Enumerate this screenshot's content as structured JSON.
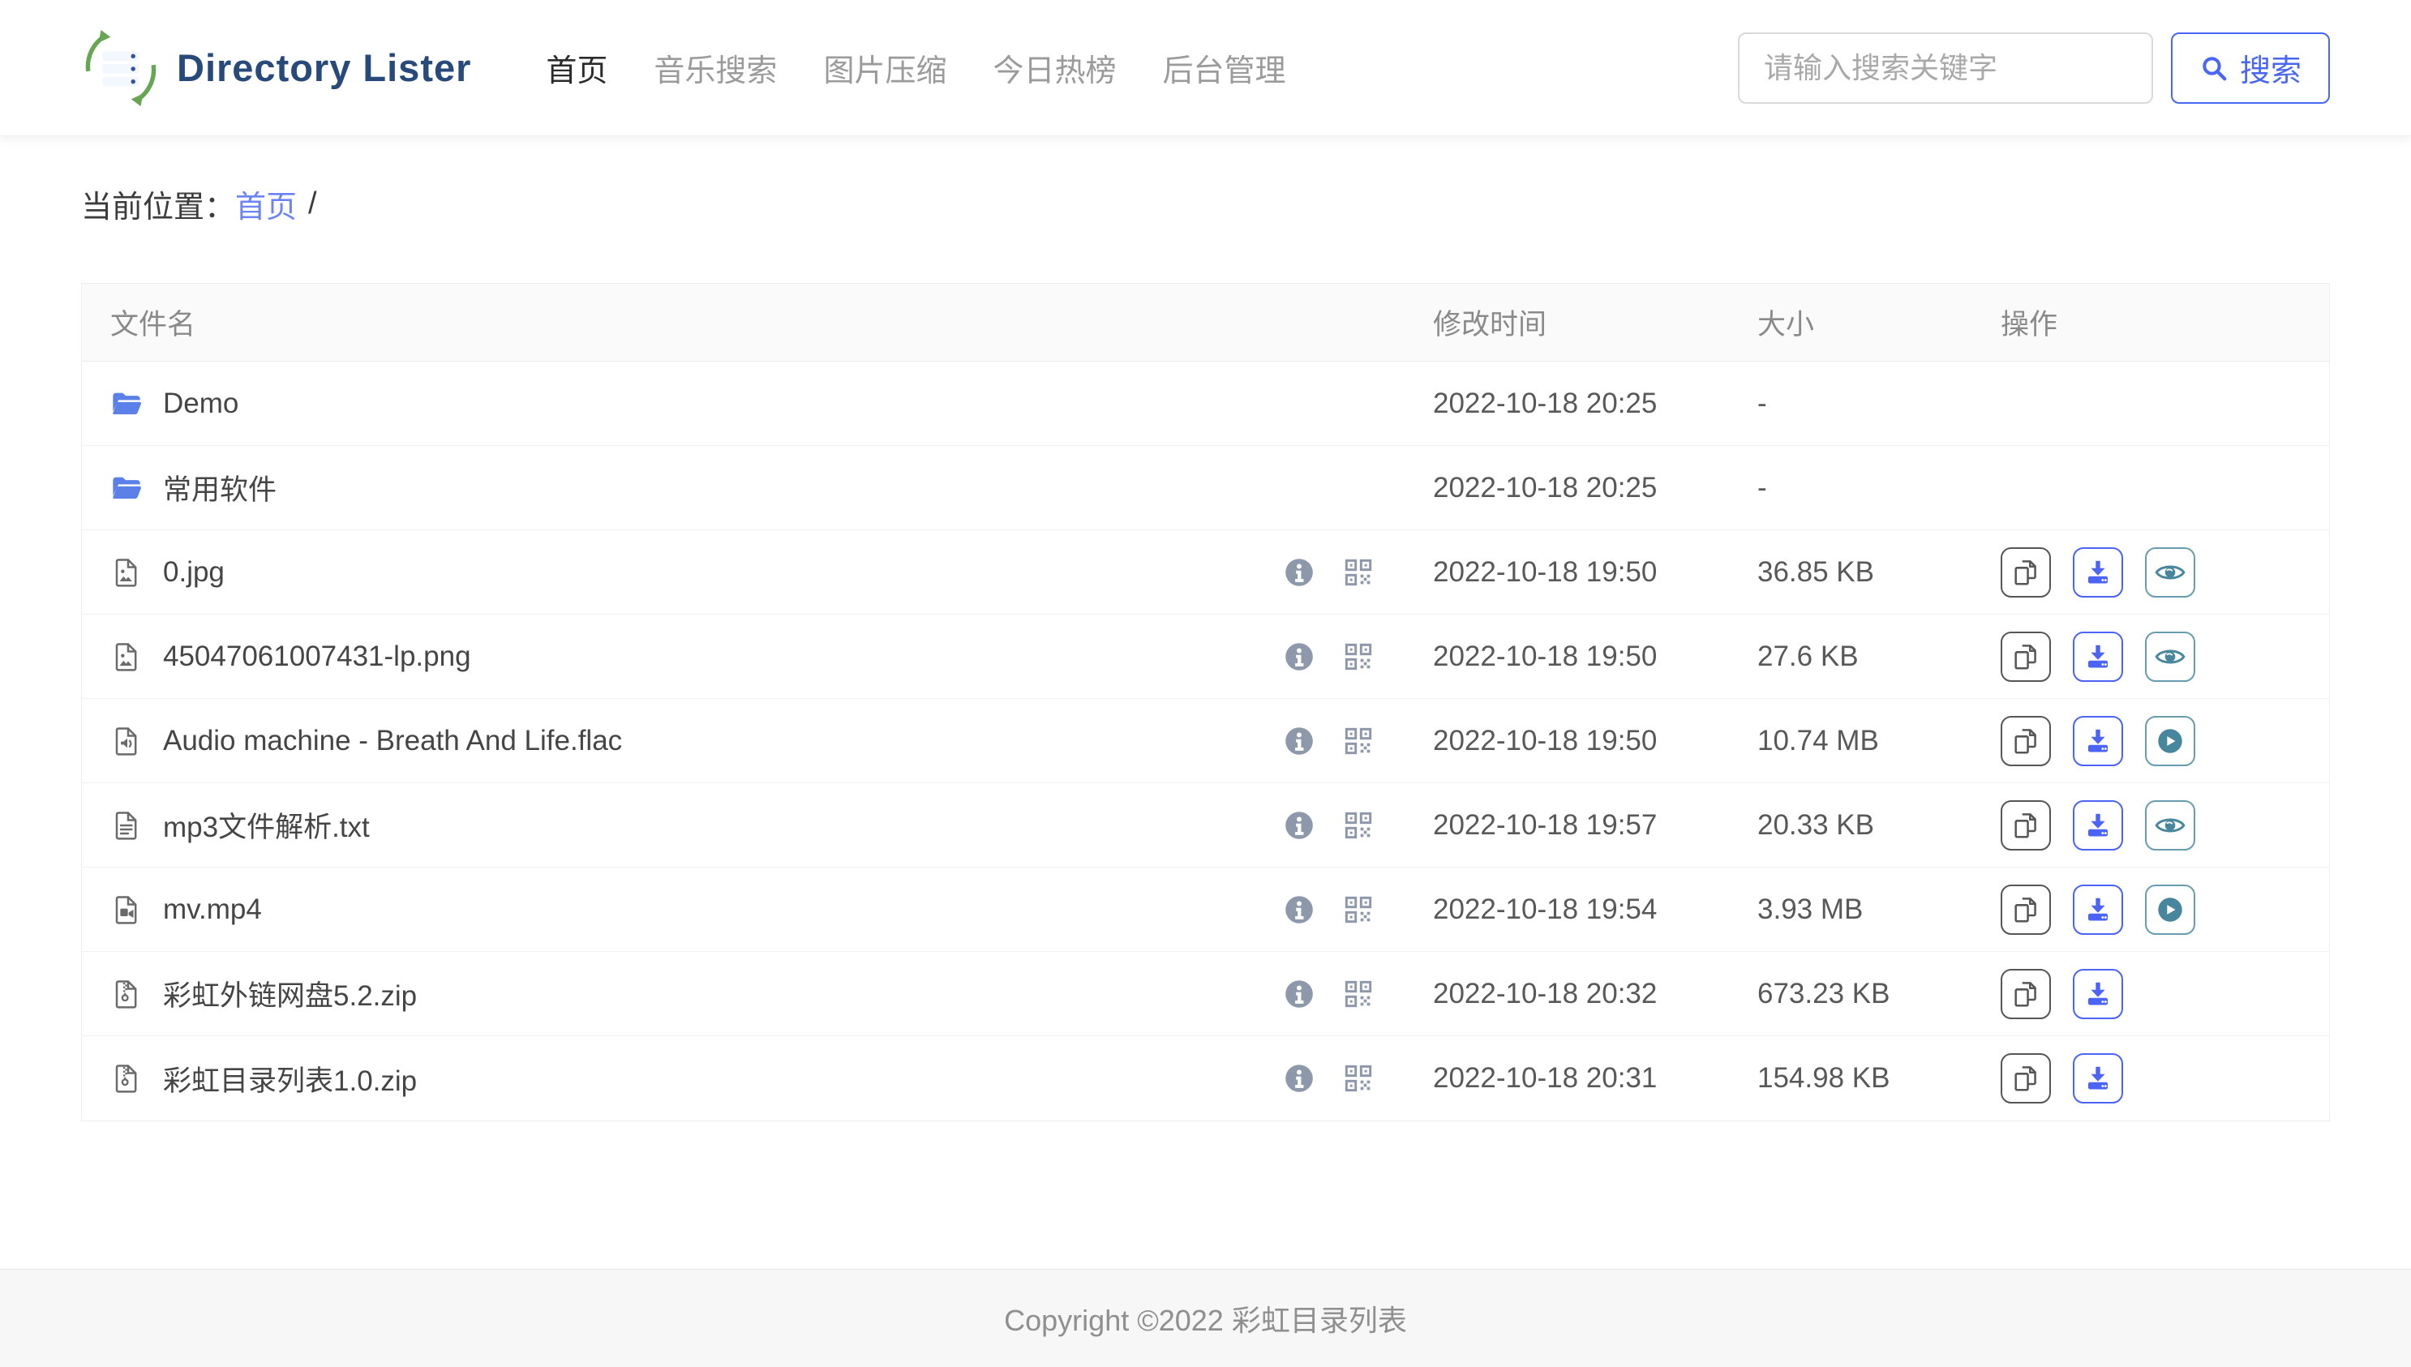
{
  "header": {
    "brand": "Directory Lister",
    "logo_icon": "hexagon-server-logo-icon",
    "nav": [
      {
        "label": "首页",
        "active": true
      },
      {
        "label": "音乐搜索",
        "active": false
      },
      {
        "label": "图片压缩",
        "active": false
      },
      {
        "label": "今日热榜",
        "active": false
      },
      {
        "label": "后台管理",
        "active": false
      }
    ],
    "search": {
      "value": "",
      "placeholder": "请输入搜索关键字",
      "button_label": "搜索",
      "button_icon": "search-icon"
    }
  },
  "breadcrumb": {
    "prefix": "当前位置：",
    "home_link": "首页",
    "separator": "/"
  },
  "table": {
    "columns": {
      "name": "文件名",
      "mtime": "修改时间",
      "size": "大小",
      "actions": "操作"
    },
    "rows": [
      {
        "name": "Demo",
        "icon": "folder-icon",
        "mtime": "2022-10-18 20:25",
        "size": "-",
        "show_meta": false,
        "actions": []
      },
      {
        "name": "常用软件",
        "icon": "folder-icon",
        "mtime": "2022-10-18 20:25",
        "size": "-",
        "show_meta": false,
        "actions": []
      },
      {
        "name": "0.jpg",
        "icon": "image-file-icon",
        "mtime": "2022-10-18 19:50",
        "size": "36.85 KB",
        "show_meta": true,
        "actions": [
          "copy",
          "download",
          "view"
        ]
      },
      {
        "name": "45047061007431-lp.png",
        "icon": "image-file-icon",
        "mtime": "2022-10-18 19:50",
        "size": "27.6 KB",
        "show_meta": true,
        "actions": [
          "copy",
          "download",
          "view"
        ]
      },
      {
        "name": "Audio machine - Breath And Life.flac",
        "icon": "audio-file-icon",
        "mtime": "2022-10-18 19:50",
        "size": "10.74 MB",
        "show_meta": true,
        "actions": [
          "copy",
          "download",
          "play"
        ]
      },
      {
        "name": "mp3文件解析.txt",
        "icon": "text-file-icon",
        "mtime": "2022-10-18 19:57",
        "size": "20.33 KB",
        "show_meta": true,
        "actions": [
          "copy",
          "download",
          "view"
        ]
      },
      {
        "name": "mv.mp4",
        "icon": "video-file-icon",
        "mtime": "2022-10-18 19:54",
        "size": "3.93 MB",
        "show_meta": true,
        "actions": [
          "copy",
          "download",
          "play"
        ]
      },
      {
        "name": "彩虹外链网盘5.2.zip",
        "icon": "zip-file-icon",
        "mtime": "2022-10-18 20:32",
        "size": "673.23 KB",
        "show_meta": true,
        "actions": [
          "copy",
          "download"
        ]
      },
      {
        "name": "彩虹目录列表1.0.zip",
        "icon": "zip-file-icon",
        "mtime": "2022-10-18 20:31",
        "size": "154.98 KB",
        "show_meta": true,
        "actions": [
          "copy",
          "download"
        ]
      }
    ],
    "meta_icons": [
      "info-icon",
      "qrcode-icon"
    ]
  },
  "footer": {
    "copyright": "Copyright ©2022 彩虹目录列表"
  },
  "colors": {
    "brand_text": "#274a7b",
    "accent_blue": "#4a66f5",
    "link_blue": "#6c83f3",
    "folder_blue": "#5b80e8",
    "download_blue": "#4b63f6",
    "preview_teal": "#47869c",
    "meta_gray_blue": "#8d99ab",
    "copy_gray": "#565656",
    "header_bg": "#ffffff",
    "table_header_bg": "#fafafa",
    "footer_bg": "#f7f7f8",
    "logo_green": "#67a653"
  }
}
